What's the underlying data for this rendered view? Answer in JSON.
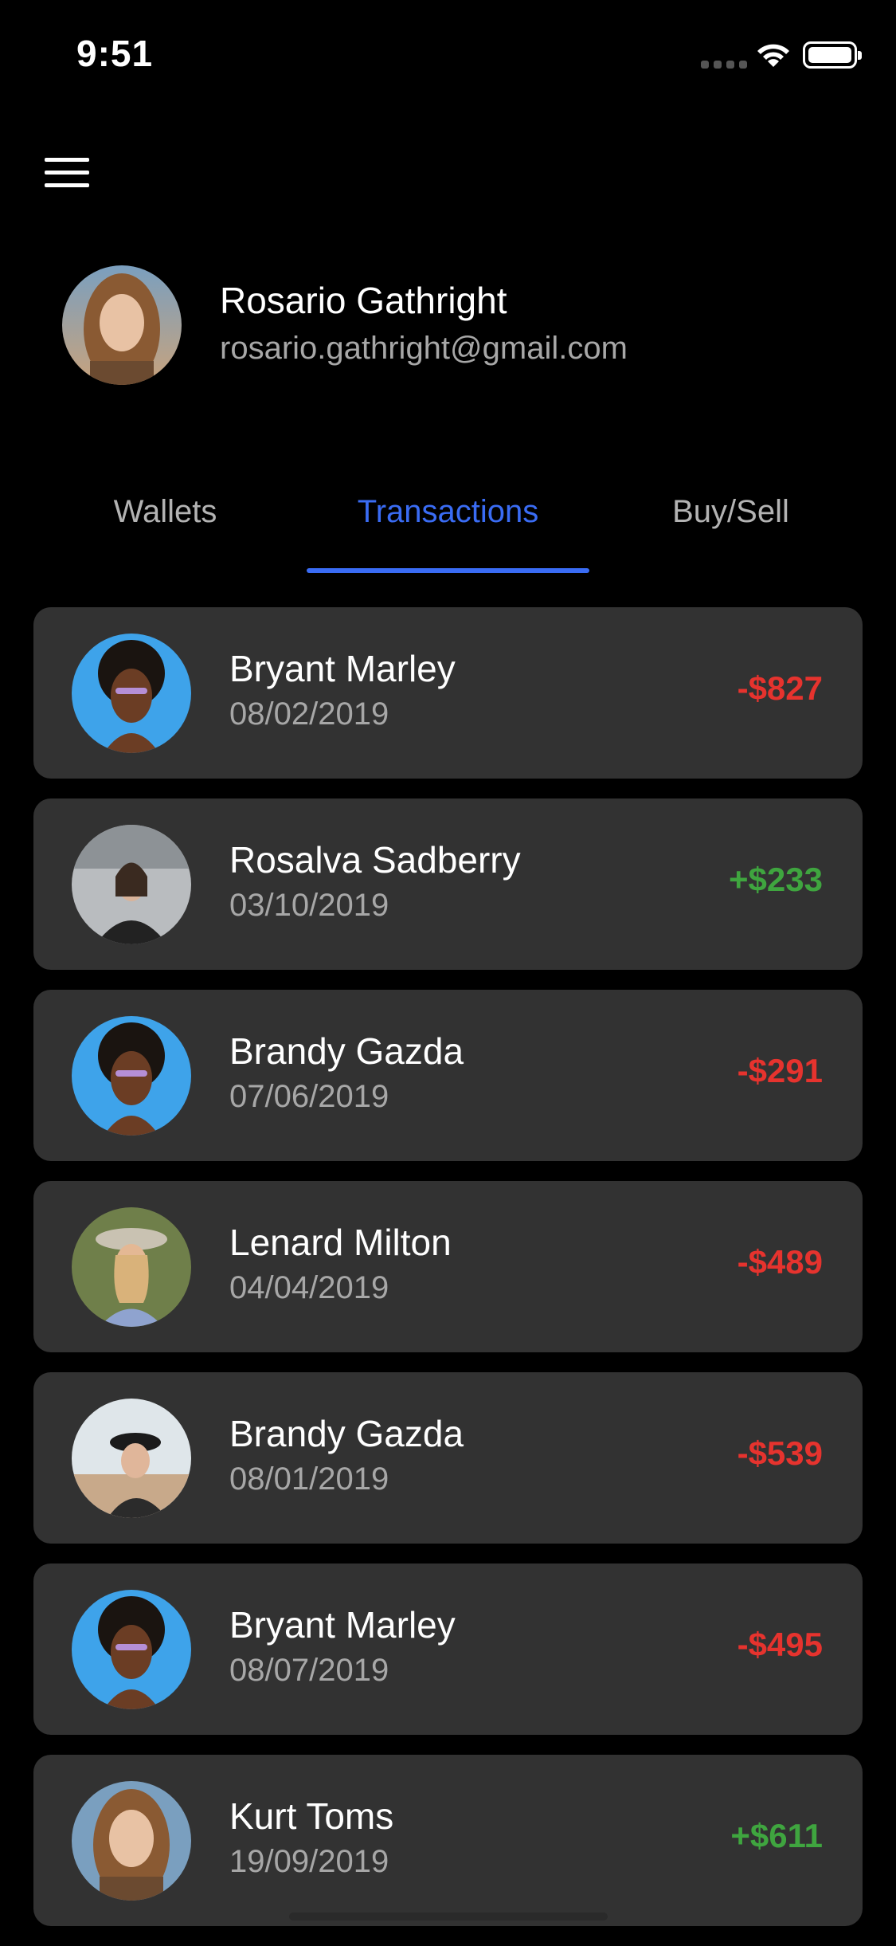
{
  "status_bar": {
    "time": "9:51"
  },
  "menu": {
    "icon": "hamburger-menu-icon"
  },
  "profile": {
    "name": "Rosario Gathright",
    "email": "rosario.gathright@gmail.com"
  },
  "tabs": [
    {
      "label": "Wallets",
      "active": false
    },
    {
      "label": "Transactions",
      "active": true
    },
    {
      "label": "Buy/Sell",
      "active": false
    }
  ],
  "colors": {
    "accent": "#3a6cf4",
    "negative": "#e6332e",
    "positive": "#3fa53f",
    "card": "#323232"
  },
  "transactions": [
    {
      "name": "Bryant Marley",
      "date": "08/02/2019",
      "amount": "-$827",
      "sign": "neg"
    },
    {
      "name": "Rosalva Sadberry",
      "date": "03/10/2019",
      "amount": "+$233",
      "sign": "pos"
    },
    {
      "name": "Brandy Gazda",
      "date": "07/06/2019",
      "amount": "-$291",
      "sign": "neg"
    },
    {
      "name": "Lenard Milton",
      "date": "04/04/2019",
      "amount": "-$489",
      "sign": "neg"
    },
    {
      "name": "Brandy Gazda",
      "date": "08/01/2019",
      "amount": "-$539",
      "sign": "neg"
    },
    {
      "name": "Bryant Marley",
      "date": "08/07/2019",
      "amount": "-$495",
      "sign": "neg"
    },
    {
      "name": "Kurt Toms",
      "date": "19/09/2019",
      "amount": "+$611",
      "sign": "pos"
    }
  ]
}
